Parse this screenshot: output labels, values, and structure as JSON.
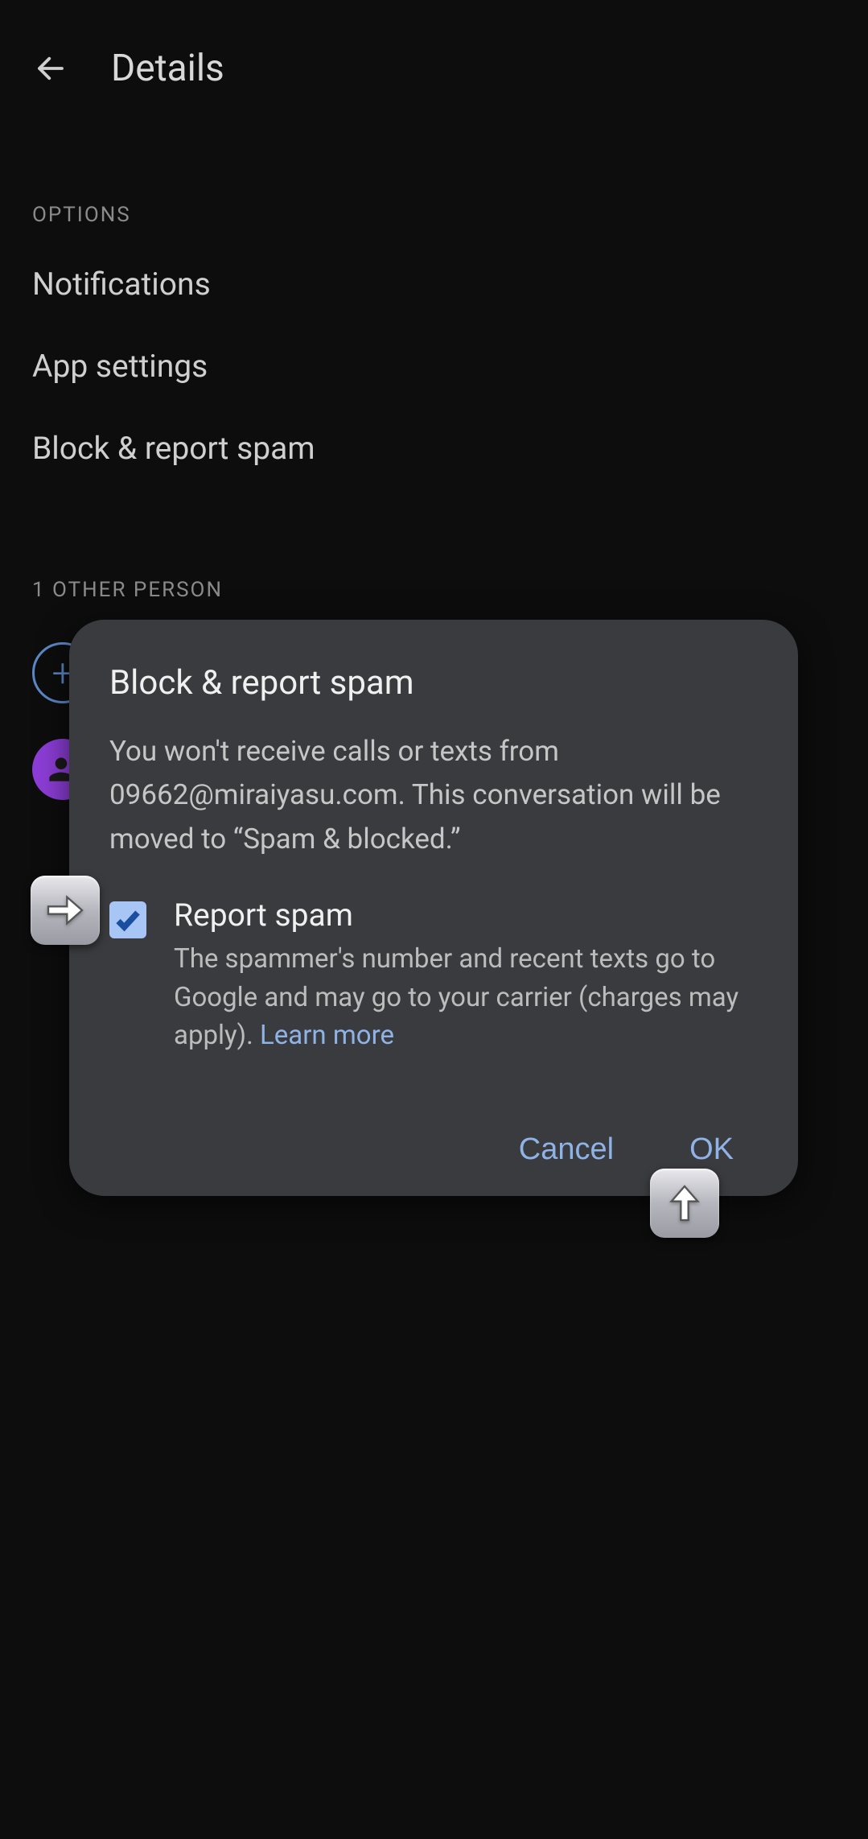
{
  "header": {
    "title": "Details"
  },
  "sections": {
    "options_label": "OPTIONS",
    "other_person_label": "1 OTHER PERSON"
  },
  "menu": {
    "notifications": "Notifications",
    "app_settings": "App settings",
    "block_report": "Block & report spam"
  },
  "add_person_glyph": "+",
  "dialog": {
    "title": "Block & report spam",
    "description": "You won't receive calls or texts from 09662@miraiyasu.com. This conversation will be moved to “Spam & blocked.”",
    "checkbox": {
      "checked": true,
      "label": "Report spam",
      "desc_before": "The spammer's number and recent texts go to Google and may go to your carrier (charges may apply). ",
      "learn_more": "Learn more"
    },
    "actions": {
      "cancel": "Cancel",
      "ok": "OK"
    }
  }
}
